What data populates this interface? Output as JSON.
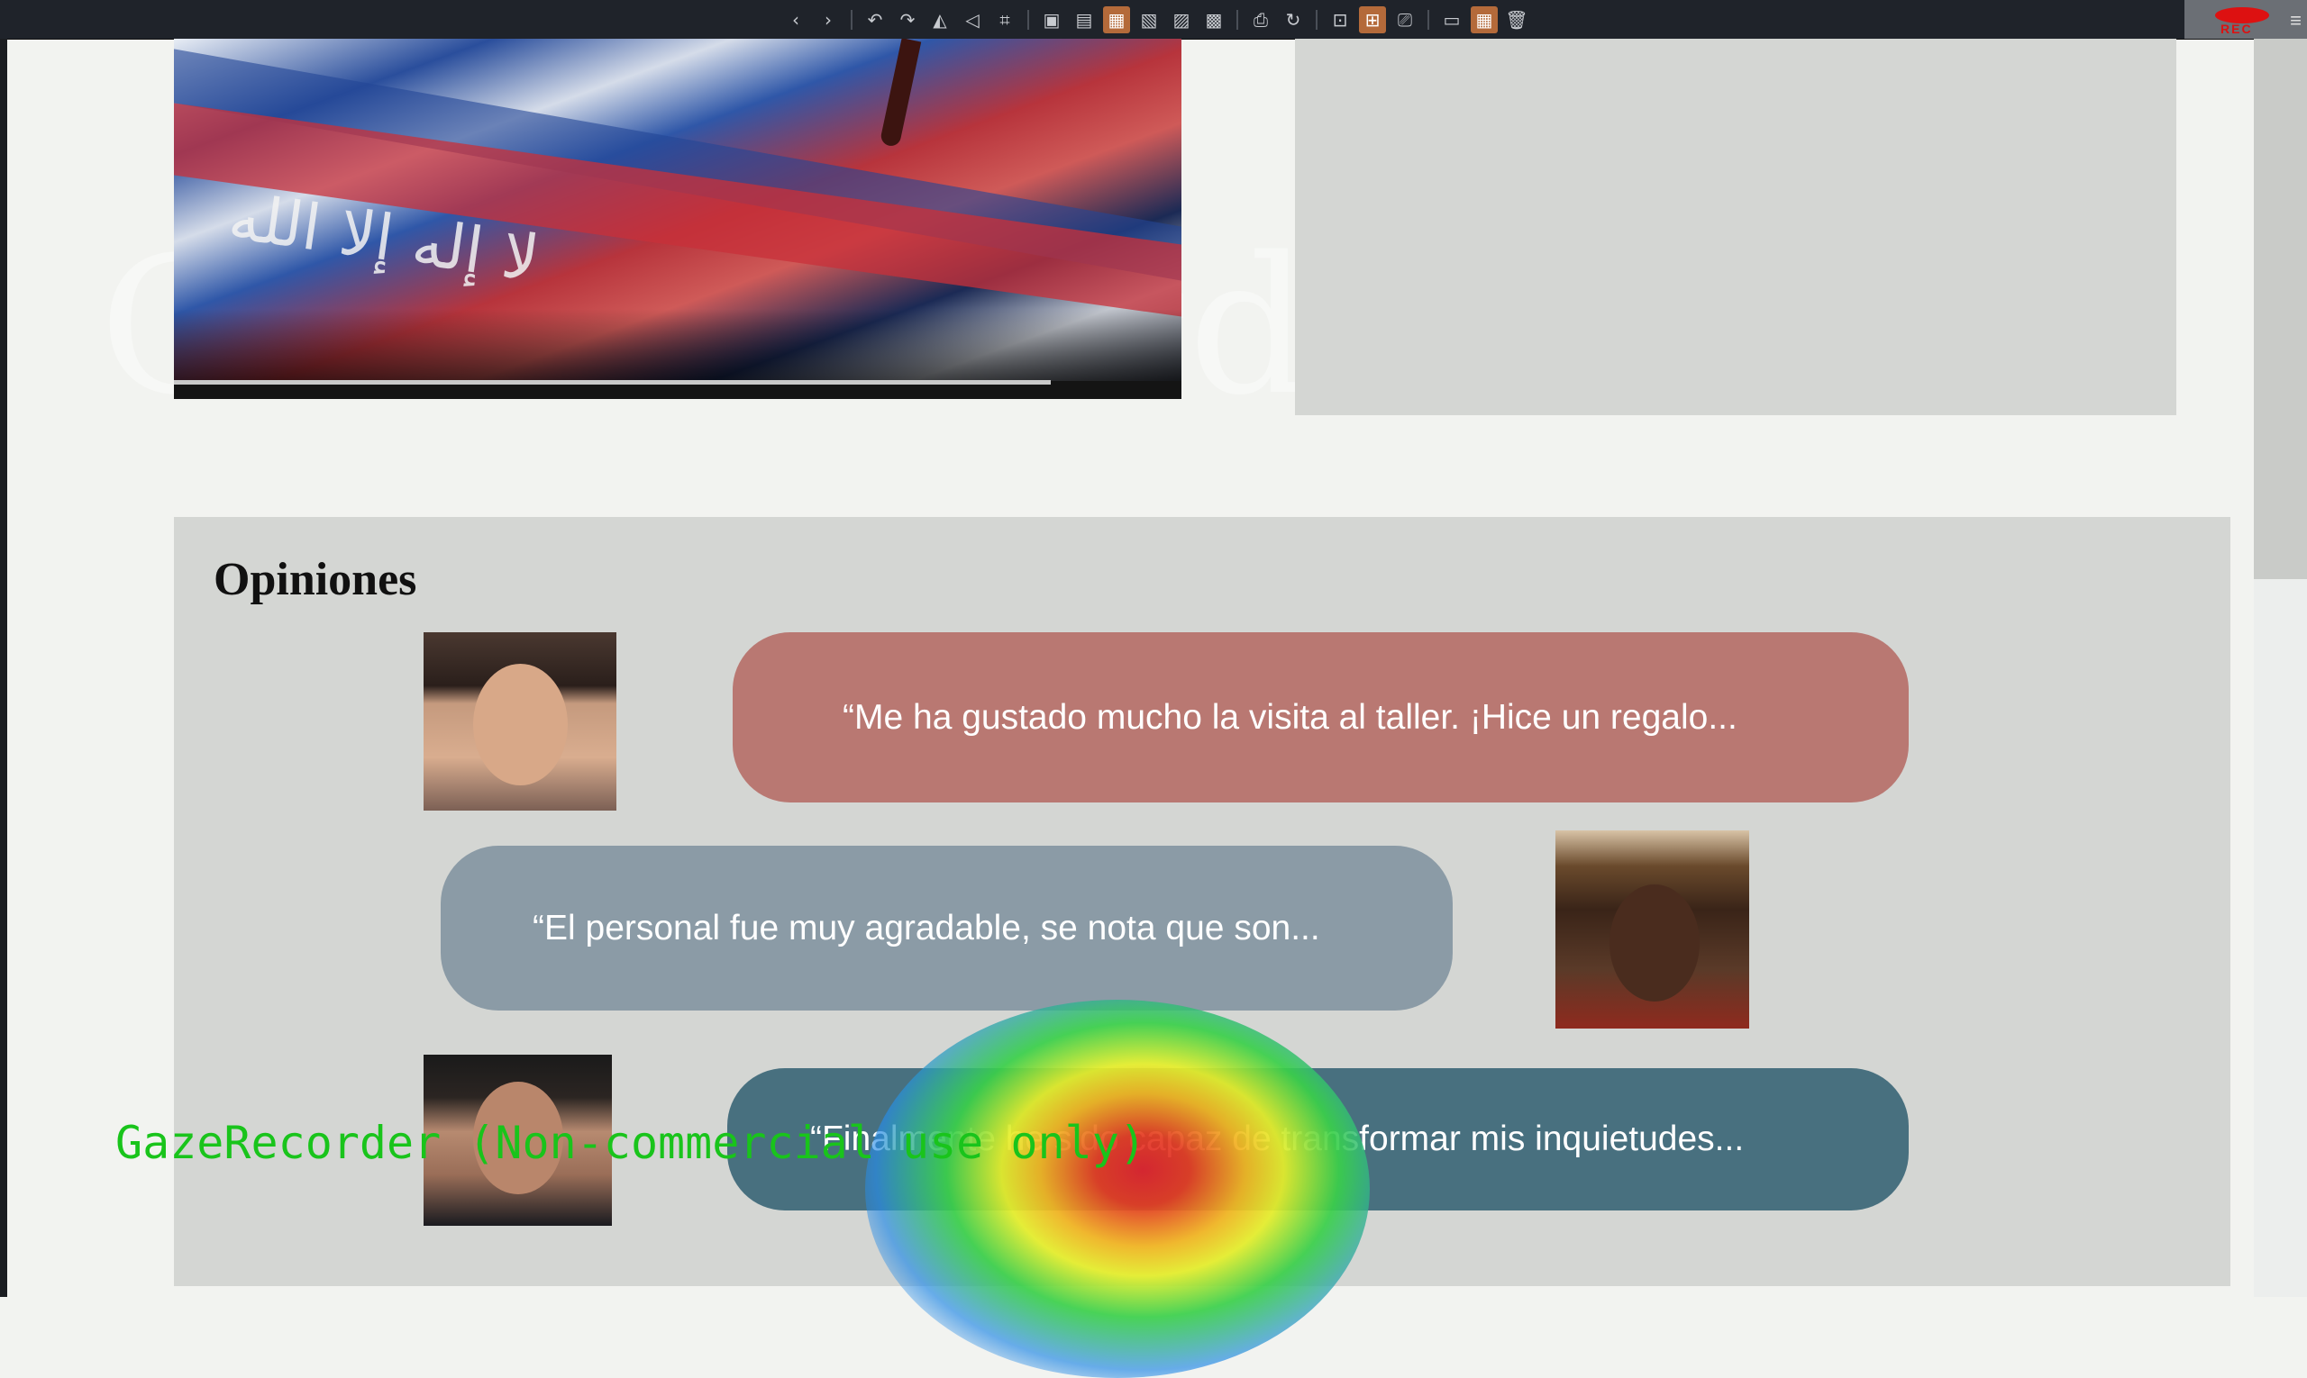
{
  "toolbar": {
    "tools": [
      {
        "icon": "chevron-left-icon",
        "glyph": "‹"
      },
      {
        "icon": "chevron-right-icon",
        "glyph": "›"
      },
      {
        "icon": "separator"
      },
      {
        "icon": "undo-icon",
        "glyph": "↶"
      },
      {
        "icon": "redo-icon",
        "glyph": "↷"
      },
      {
        "icon": "flip-icon",
        "glyph": "◭"
      },
      {
        "icon": "send-icon",
        "glyph": "◁"
      },
      {
        "icon": "crop-icon",
        "glyph": "⌗"
      },
      {
        "icon": "separator"
      },
      {
        "icon": "frame-icon",
        "glyph": "▣"
      },
      {
        "icon": "lock-icon",
        "glyph": "▤"
      },
      {
        "icon": "image-layout-icon",
        "glyph": "▦",
        "active": true
      },
      {
        "icon": "image-grid-icon",
        "glyph": "▧"
      },
      {
        "icon": "region-icon",
        "glyph": "▨"
      },
      {
        "icon": "strip-icon",
        "glyph": "▩"
      },
      {
        "icon": "separator"
      },
      {
        "icon": "print-icon",
        "glyph": "⎙"
      },
      {
        "icon": "refresh-icon",
        "glyph": "↻"
      },
      {
        "icon": "separator"
      },
      {
        "icon": "expand-icon",
        "glyph": "⊡"
      },
      {
        "icon": "zoom-area-icon",
        "glyph": "⊞",
        "active": true
      },
      {
        "icon": "picture-icon",
        "glyph": "⎚"
      },
      {
        "icon": "separator"
      },
      {
        "icon": "image-icon",
        "glyph": "▭"
      },
      {
        "icon": "grid-icon",
        "glyph": "▦",
        "active": true
      },
      {
        "icon": "trash-icon",
        "glyph": "🗑"
      }
    ],
    "rec_label": "REC",
    "accent": "#b46a3a"
  },
  "hero": {
    "watermark_text": "GazeRecorder",
    "video_progress": 0.87
  },
  "opinions": {
    "title": "Opiniones",
    "items": [
      {
        "quote": "“Me ha gustado mucho la visita al taller. ¡Hice un regalo...",
        "color": "#b97872"
      },
      {
        "quote": "“El personal fue muy agradable, se nota que son...",
        "color": "#8b9ba6"
      },
      {
        "quote": "“Finalmente he sido capaz de transformar mis inquietudes...",
        "color": "#48707f"
      }
    ]
  },
  "overlay": {
    "gaze_label": "GazeRecorder (Non-commercial use only)"
  }
}
